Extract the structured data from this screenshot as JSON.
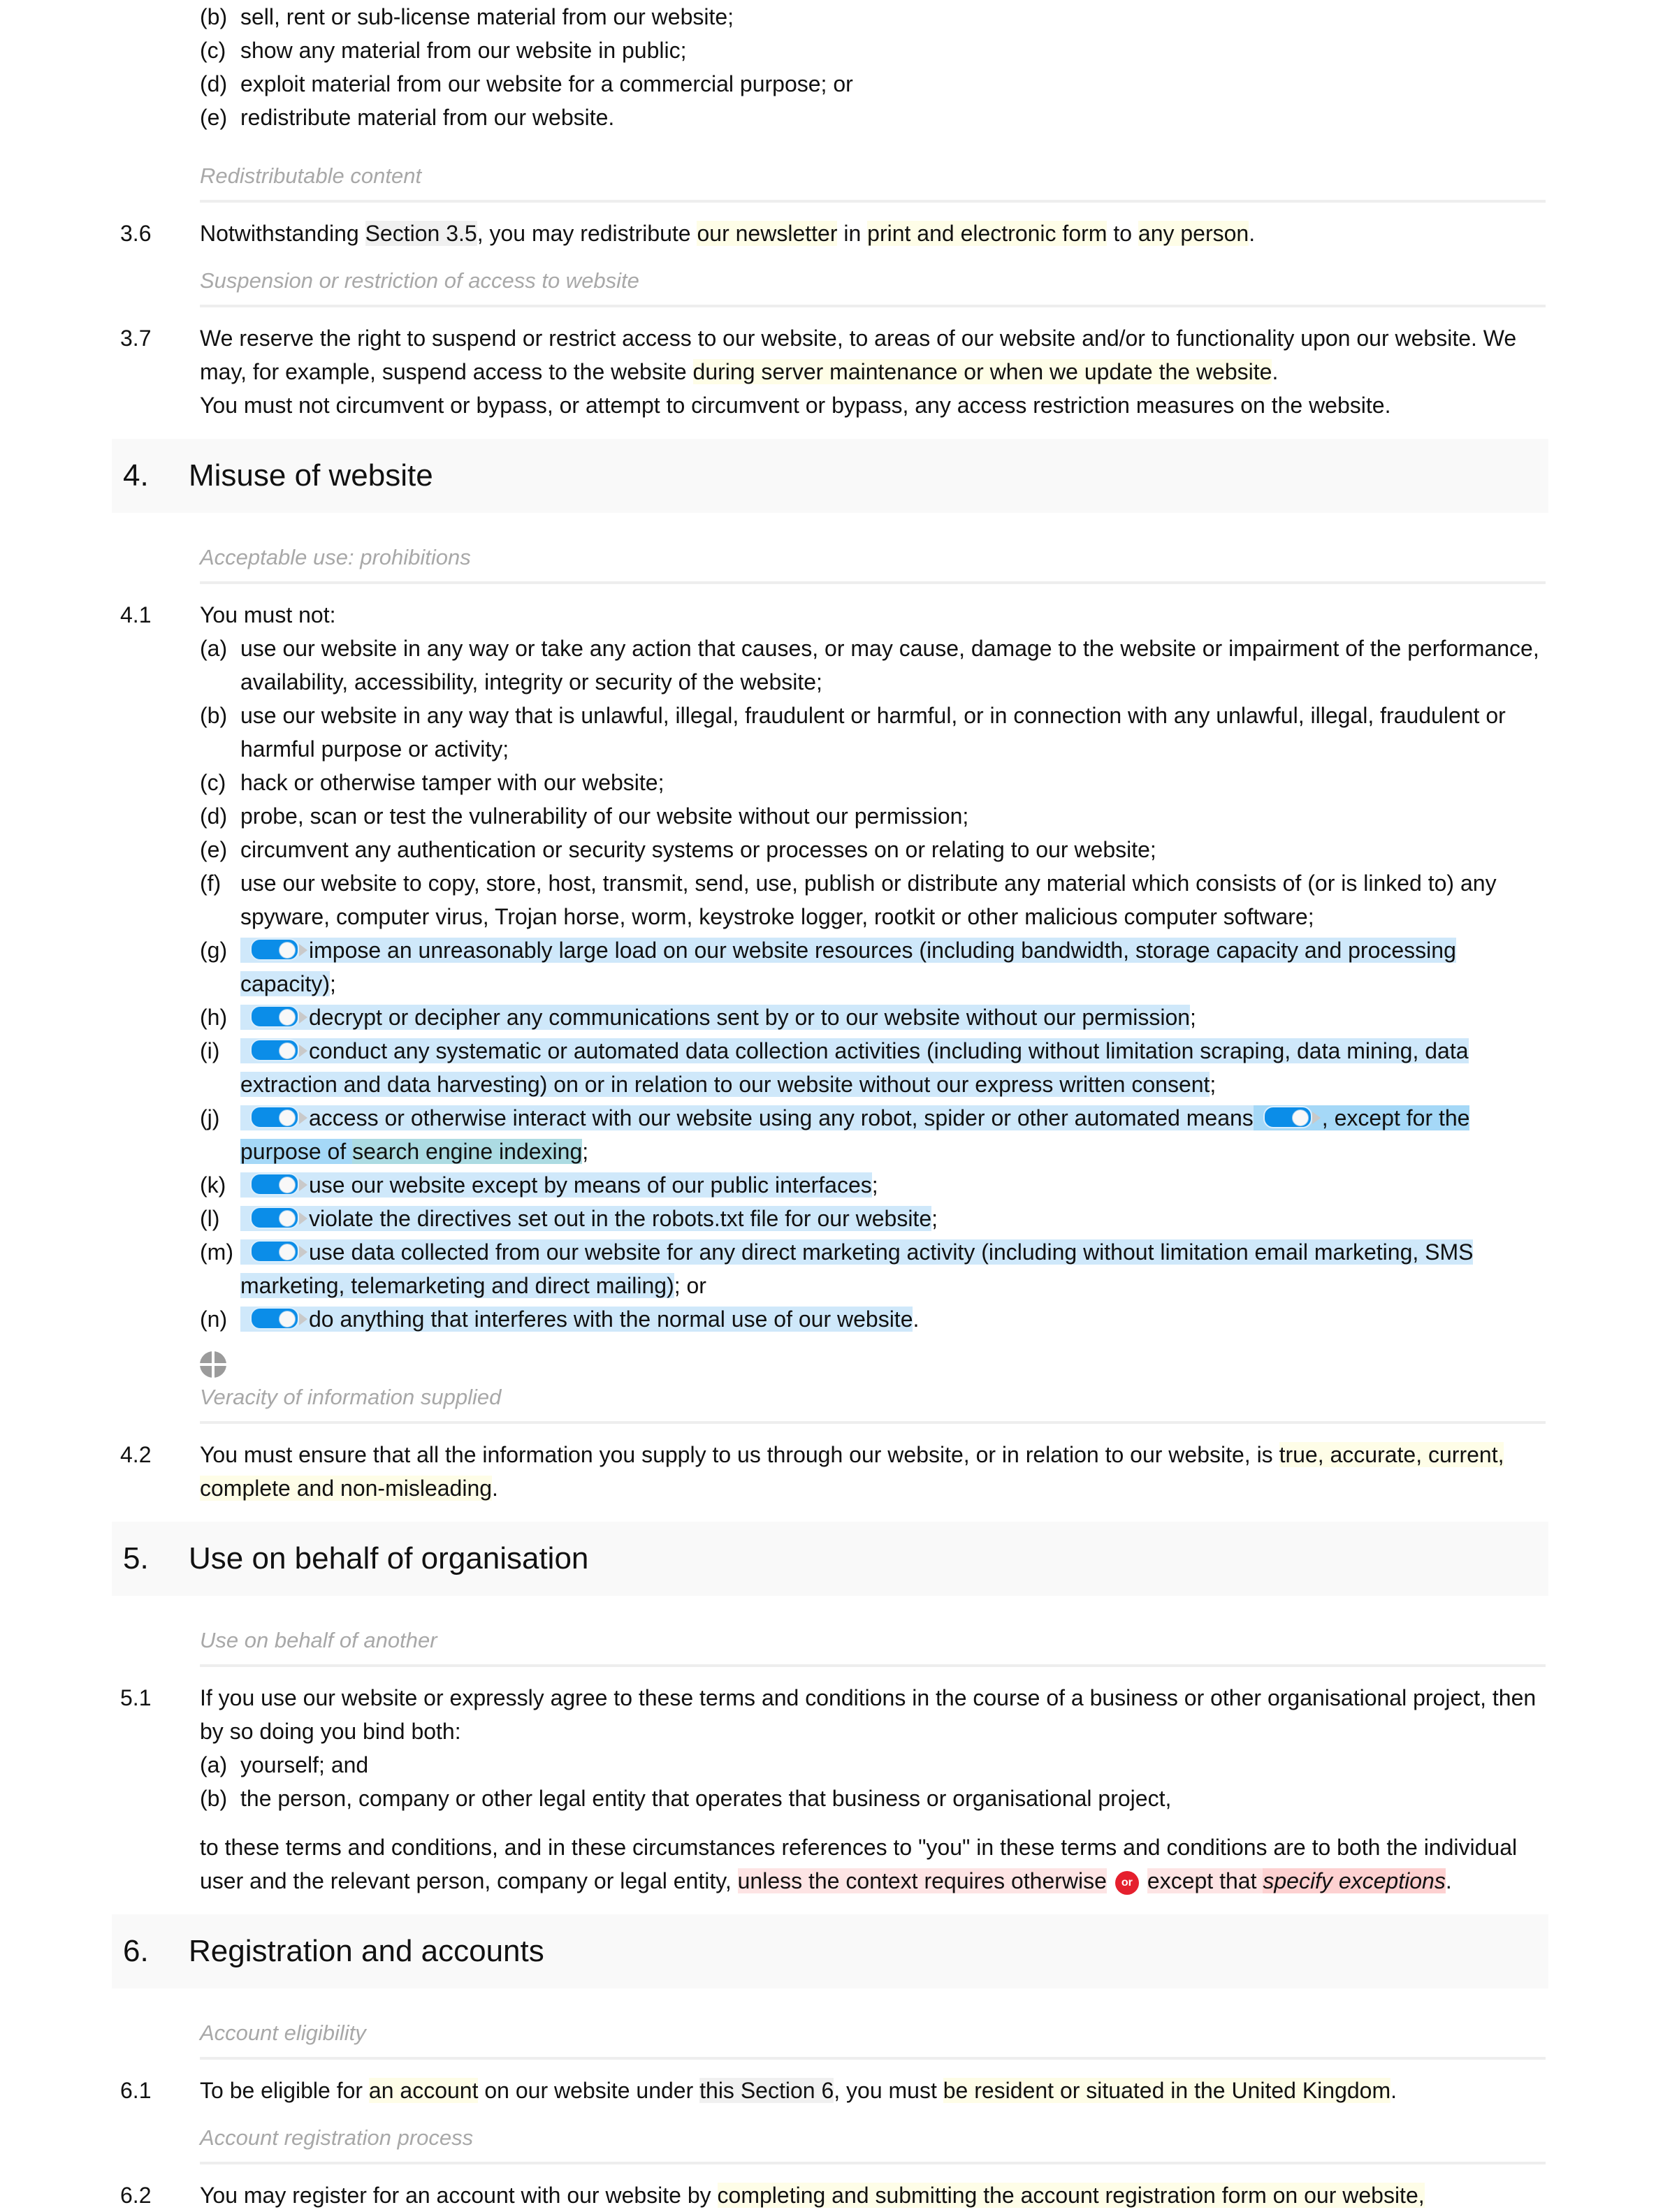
{
  "section3_tail": {
    "items": [
      {
        "label": "(b)",
        "text": "sell, rent or sub-license material from our website;"
      },
      {
        "label": "(c)",
        "text": "show any material from our website in public;"
      },
      {
        "label": "(d)",
        "text": "exploit material from our website for a commercial purpose; or"
      },
      {
        "label": "(e)",
        "text": "redistribute material from our website."
      }
    ],
    "sub36": "Redistributable content",
    "c36": {
      "num": "3.6",
      "t1": "Notwithstanding ",
      "ref": "Section 3.5",
      "t2": ", you may redistribute ",
      "v1": "our newsletter",
      "t3": " in ",
      "v2": "print and electronic form",
      "t4": " to ",
      "v3": "any person",
      "t5": "."
    },
    "sub37": "Suspension or restriction of access to website",
    "c37": {
      "num": "3.7",
      "t1": "We reserve the right to suspend or restrict access to our website, to areas of our website and/or to functionality upon our website. We may, for example, suspend access to the website ",
      "v1": "during server maintenance or when we update the website",
      "t2": ".",
      "t3": "You must not circumvent or bypass, or attempt to circumvent or bypass, any access restriction measures on the website."
    }
  },
  "section4": {
    "num": "4.",
    "title": "Misuse of website",
    "sub41": "Acceptable use: prohibitions",
    "c41": {
      "num": "4.1",
      "intro": "You must not:",
      "items": [
        {
          "label": "(a)",
          "text": "use our website in any way or take any action that causes, or may cause, damage to the website or impairment of the performance, availability, accessibility, integrity or security of the website;"
        },
        {
          "label": "(b)",
          "text": "use our website in any way that is unlawful, illegal, fraudulent or harmful, or in connection with any unlawful, illegal, fraudulent or harmful purpose or activity;"
        },
        {
          "label": "(c)",
          "text": "hack or otherwise tamper with our website;"
        },
        {
          "label": "(d)",
          "text": "probe, scan or test the vulnerability of our website without our permission;"
        },
        {
          "label": "(e)",
          "text": "circumvent any authentication or security systems or processes on or relating to our website;"
        },
        {
          "label": "(f)",
          "text": "use our website to copy, store, host, transmit, send, use, publish or distribute any material which consists of (or is linked to) any spyware, computer virus, Trojan horse, worm, keystroke logger, rootkit or other malicious computer software;"
        }
      ],
      "optional_items": [
        {
          "label": "(g)",
          "text": "impose an unreasonably large load on our website resources (including bandwidth, storage capacity and processing capacity)",
          "end": ";",
          "enabled": true
        },
        {
          "label": "(h)",
          "text": "decrypt or decipher any communications sent by or to our website without our permission",
          "end": ";",
          "enabled": true
        },
        {
          "label": "(i)",
          "text": "conduct any systematic or automated data collection activities (including without limitation scraping, data mining, data extraction and data harvesting) on or in relation to our website without our express written consent",
          "end": ";",
          "enabled": true
        },
        {
          "label": "(j)",
          "text": "access or otherwise interact with our website using any robot, spider or other automated means",
          "nested_text": ", except for the purpose of ",
          "nested_var": "search engine indexing",
          "end": ";",
          "enabled": true,
          "nested_enabled": true
        },
        {
          "label": "(k)",
          "text": "use our website except by means of our public interfaces",
          "end": ";",
          "enabled": true
        },
        {
          "label": "(l)",
          "text": "violate the directives set out in the robots.txt file for our website",
          "end": ";",
          "enabled": true
        },
        {
          "label": "(m)",
          "text": "use data collected from our website for any direct marketing activity (including without limitation email marketing, SMS marketing, telemarketing and direct mailing)",
          "end": "; or",
          "enabled": true
        },
        {
          "label": "(n)",
          "text": "do anything that interferes with the normal use of our website",
          "end": ".",
          "enabled": true
        }
      ]
    },
    "sub42": "Veracity of information supplied",
    "c42": {
      "num": "4.2",
      "t1": "You must ensure that all the information you supply to us through our website, or in relation to our website, is ",
      "v1": "true, accurate, current, complete and non-misleading",
      "t2": "."
    }
  },
  "section5": {
    "num": "5.",
    "title": "Use on behalf of organisation",
    "sub51": "Use on behalf of another",
    "c51": {
      "num": "5.1",
      "intro": "If you use our website or expressly agree to these terms and conditions in the course of a business or other organisational project, then by so doing you bind both:",
      "items": [
        {
          "label": "(a)",
          "text": "yourself; and"
        },
        {
          "label": "(b)",
          "text": "the person, company or other legal entity that operates that business or organisational project,"
        }
      ],
      "tail1": "to these terms and conditions, and in these circumstances references to \"you\" in these terms and conditions are to both the individual user and the relevant person, company or legal entity, ",
      "alt1": "unless the context requires otherwise",
      "or_label": "or",
      "alt2": "except that ",
      "alt2_var": "specify exceptions",
      "tail2": "."
    }
  },
  "section6": {
    "num": "6.",
    "title": "Registration and accounts",
    "sub61": "Account eligibility",
    "c61": {
      "num": "6.1",
      "t1": "To be eligible for ",
      "v1": "an account",
      "t2": " on our website under ",
      "ref": "this Section 6",
      "t3": ", you must ",
      "v2": "be resident or situated in the United Kingdom",
      "t4": "."
    },
    "sub62": "Account registration process",
    "c62": {
      "num": "6.2",
      "t1": "You may register for an account with our website by ",
      "v1": "completing and submitting the account registration form on our website,"
    }
  },
  "colors": {
    "variable_highlight": "#fefde7",
    "reference_highlight": "#f0f0f0",
    "optional_highlight": "#cfe8fa",
    "alternative_highlight": "#fde4e4",
    "toggle_on": "#0b8de8",
    "or_badge": "#e5202e"
  }
}
